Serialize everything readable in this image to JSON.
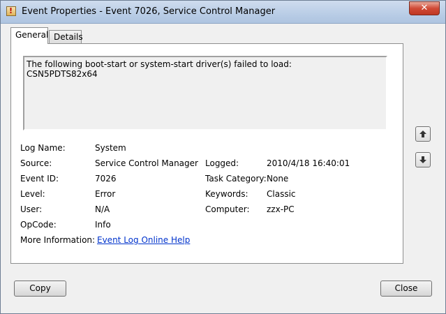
{
  "window": {
    "title": "Event Properties - Event 7026, Service Control Manager",
    "close_label": "✕"
  },
  "tabs": [
    {
      "label": "General",
      "selected": true
    },
    {
      "label": "Details",
      "selected": false
    }
  ],
  "message": {
    "line1": "The following boot-start or system-start driver(s) failed to load:",
    "line2": "CSN5PDTS82x64"
  },
  "fields": {
    "log_name": {
      "label": "Log Name:",
      "value": "System"
    },
    "source": {
      "label": "Source:",
      "value": "Service Control Manager"
    },
    "logged": {
      "label": "Logged:",
      "value": "2010/4/18 16:40:01"
    },
    "event_id": {
      "label": "Event ID:",
      "value": "7026"
    },
    "task_category": {
      "label": "Task Category:",
      "value": "None"
    },
    "level": {
      "label": "Level:",
      "value": "Error"
    },
    "keywords": {
      "label": "Keywords:",
      "value": "Classic"
    },
    "user": {
      "label": "User:",
      "value": "N/A"
    },
    "computer": {
      "label": "Computer:",
      "value": "zzx-PC"
    },
    "opcode": {
      "label": "OpCode:",
      "value": "Info"
    },
    "more_info": {
      "label": "More Information:",
      "value": "Event Log Online Help"
    }
  },
  "buttons": {
    "copy": "Copy",
    "close": "Close",
    "up_icon": "up-arrow",
    "down_icon": "down-arrow"
  }
}
